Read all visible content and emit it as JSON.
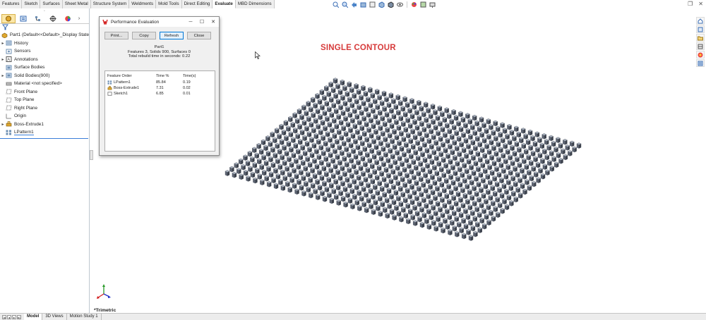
{
  "command_tabs": [
    {
      "label": "Features",
      "active": false
    },
    {
      "label": "Sketch",
      "active": false
    },
    {
      "label": "Surfaces",
      "active": false
    },
    {
      "label": "Sheet Metal",
      "active": false
    },
    {
      "label": "Structure System",
      "active": false
    },
    {
      "label": "Weldments",
      "active": false
    },
    {
      "label": "Mold Tools",
      "active": false
    },
    {
      "label": "Direct Editing",
      "active": false
    },
    {
      "label": "Evaluate",
      "active": true
    },
    {
      "label": "MBD Dimensions",
      "active": false
    }
  ],
  "manager_panel": {
    "grip": "◦",
    "tabs": [
      "feature-manager",
      "property-manager",
      "configuration-manager",
      "dimxpert-manager",
      "display-manager"
    ],
    "tree": [
      {
        "label": "Part1  (Default<<Default>_Display State",
        "expand": "",
        "icon": "part-icon",
        "color": "#e0a82e"
      },
      {
        "label": "History",
        "expand": "▸",
        "icon": "history-icon",
        "color": "#6d8fb3"
      },
      {
        "label": "Sensors",
        "expand": "",
        "icon": "sensors-icon",
        "color": "#6d8fb3"
      },
      {
        "label": "Annotations",
        "expand": "▸",
        "icon": "annotations-icon",
        "color": "#555"
      },
      {
        "label": "Surface Bodies",
        "expand": "",
        "icon": "surface-bodies-icon",
        "color": "#6d8fb3"
      },
      {
        "label": "Solid Bodies(900)",
        "expand": "▸",
        "icon": "solid-bodies-icon",
        "color": "#6d8fb3"
      },
      {
        "label": "Material <not specified>",
        "expand": "",
        "icon": "material-icon",
        "color": "#888"
      },
      {
        "label": "Front Plane",
        "expand": "",
        "icon": "plane-icon",
        "color": "#888"
      },
      {
        "label": "Top Plane",
        "expand": "",
        "icon": "plane-icon",
        "color": "#888"
      },
      {
        "label": "Right Plane",
        "expand": "",
        "icon": "plane-icon",
        "color": "#888"
      },
      {
        "label": "Origin",
        "expand": "",
        "icon": "origin-icon",
        "color": "#888"
      },
      {
        "label": "Boss-Extrude1",
        "expand": "▸",
        "icon": "boss-extrude-icon",
        "color": "#e0a82e"
      },
      {
        "label": "LPattern1",
        "expand": "",
        "icon": "linear-pattern-icon",
        "color": "#6d8fb3"
      }
    ]
  },
  "perf_dialog": {
    "title": "Performance Evaluation",
    "buttons": {
      "print": "Print...",
      "copy": "Copy",
      "refresh": "Refresh",
      "close": "Close"
    },
    "part": "Part1",
    "summary": "Features 3, Solids 900, Surfaces 0",
    "rebuild": "Total rebuild time in seconds: 0.22",
    "headers": {
      "order": "Feature Order",
      "pct": "Time %",
      "sec": "Time(s)"
    },
    "rows": [
      {
        "name": "LPattern1",
        "pct": "85.84",
        "sec": "0.19",
        "icon": "linear-pattern-icon"
      },
      {
        "name": "Boss-Extrude1",
        "pct": "7.31",
        "sec": "0.02",
        "icon": "boss-extrude-icon"
      },
      {
        "name": "Sketch1",
        "pct": "6.85",
        "sec": "0.01",
        "icon": "sketch-icon"
      }
    ]
  },
  "viewport": {
    "title": "SINGLE CONTOUR",
    "view_label": "*Trimetric",
    "title_color": "#d73b3b",
    "pattern": {
      "rows": 25,
      "columns": 36
    }
  },
  "bottom_tabs": [
    {
      "label": "Model",
      "active": true
    },
    {
      "label": "3D Views",
      "active": false
    },
    {
      "label": "Motion Study 1",
      "active": false
    }
  ],
  "window_controls": {
    "restore": "❐",
    "close": "✕"
  }
}
